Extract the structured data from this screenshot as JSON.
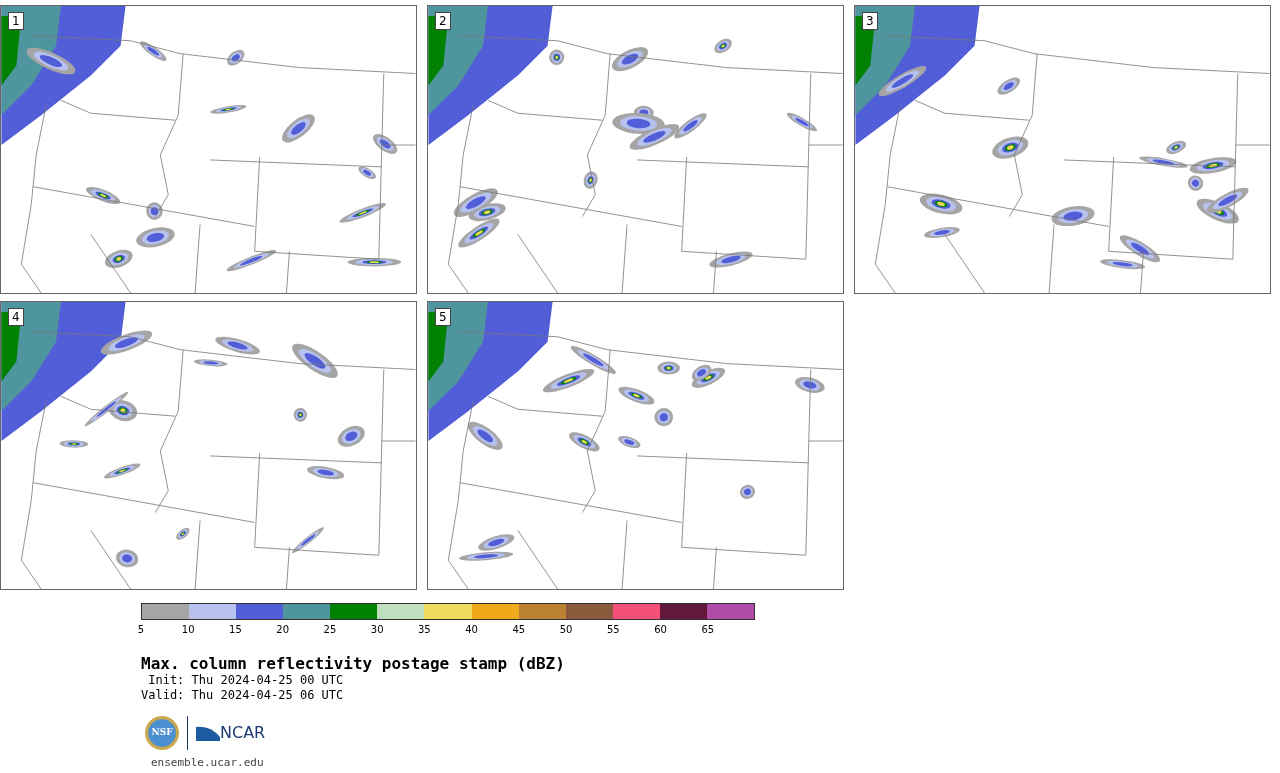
{
  "panels": [
    {
      "label": "1"
    },
    {
      "label": "2"
    },
    {
      "label": "3"
    },
    {
      "label": "4"
    },
    {
      "label": "5"
    }
  ],
  "colorbar": {
    "bins": [
      {
        "color": "#a5a5a5"
      },
      {
        "color": "#b7c1ee"
      },
      {
        "color": "#525ed8"
      },
      {
        "color": "#4e959e"
      },
      {
        "color": "#008200"
      },
      {
        "color": "#bfdfbf"
      },
      {
        "color": "#f0d95c"
      },
      {
        "color": "#efaa1b"
      },
      {
        "color": "#bb8232"
      },
      {
        "color": "#8b5a3c"
      },
      {
        "color": "#f4507a"
      },
      {
        "color": "#621838"
      },
      {
        "color": "#ae4ba6"
      }
    ],
    "ticks": [
      "5",
      "10",
      "15",
      "20",
      "25",
      "30",
      "35",
      "40",
      "45",
      "50",
      "55",
      "60",
      "65"
    ]
  },
  "title": "Max. column reflectivity postage stamp (dBZ)",
  "init": " Init: Thu 2024-04-25 00 UTC",
  "valid": "Valid: Thu 2024-04-25 06 UTC",
  "logos": {
    "nsf": "NSF",
    "ncar": "NCAR"
  },
  "url": "ensemble.ucar.edu"
}
